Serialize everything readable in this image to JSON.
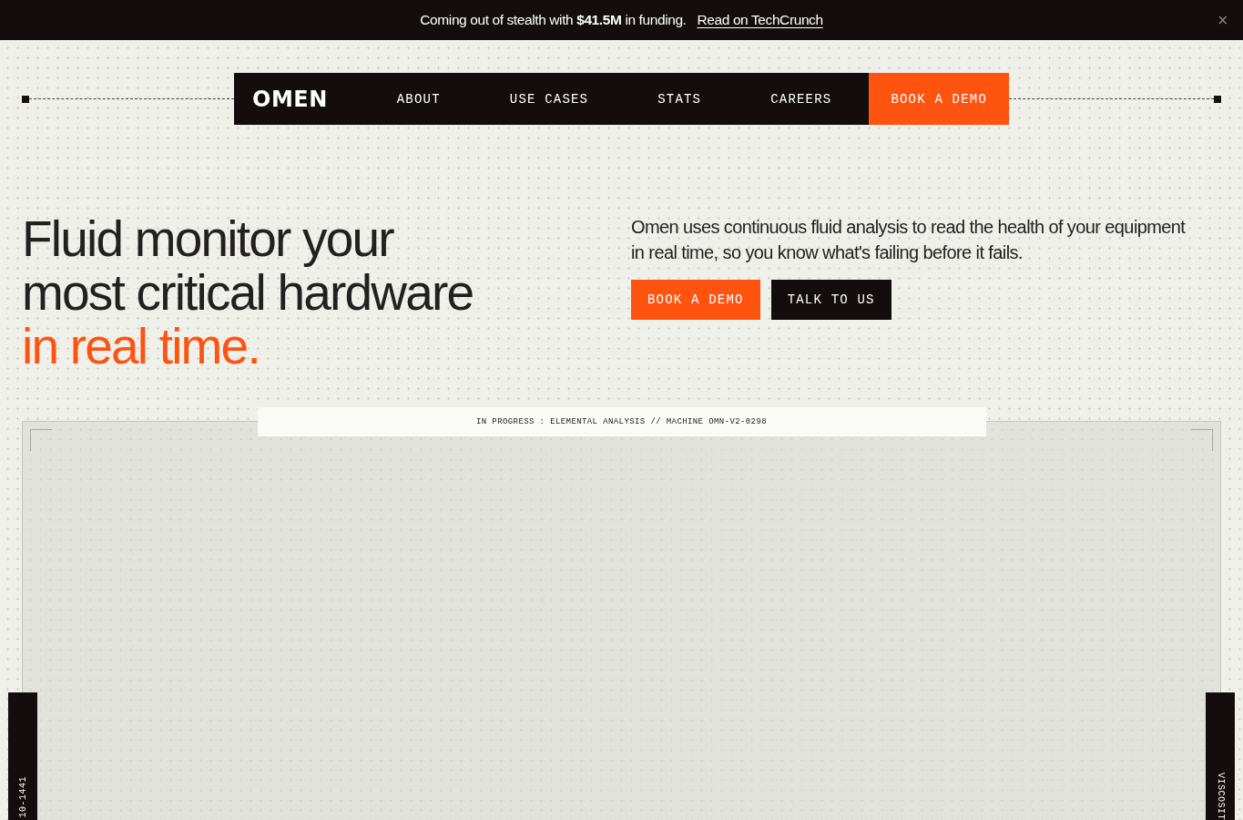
{
  "announcement": {
    "text": "Coming out of stealth with **$41.5M** in funding.",
    "link": "Read on TechCrunch",
    "close": "×"
  },
  "nav": {
    "logo": "OMEN",
    "items": [
      {
        "label": "ABOUT",
        "kind": "link"
      },
      {
        "label": "USE CASES",
        "kind": "link"
      },
      {
        "label": "STATS",
        "kind": "link"
      },
      {
        "label": "CAREERS",
        "kind": "link"
      },
      {
        "label": "BOOK A DEMO",
        "kind": "cta"
      }
    ]
  },
  "hero": {
    "headline_lines": [
      {
        "text": "Fluid monitor your",
        "accent": false
      },
      {
        "text": "most critical hardware",
        "accent": false
      },
      {
        "text": "in real time.",
        "accent": true
      }
    ],
    "description": "Omen uses continuous fluid analysis to read the health of your equipment in real time, so you know what's failing before it fails.",
    "buttons": [
      {
        "label": "BOOK A DEMO",
        "kind": "primary"
      },
      {
        "label": "TALK TO US",
        "kind": "secondary"
      }
    ]
  },
  "panel": {
    "status_label": "IN PROGRESS : ELEMENTAL ANALYSIS // MACHINE OMN-V2-0298",
    "side_tabs": [
      {
        "text": "10-1441",
        "kind": "left"
      },
      {
        "text": "VISCOSIT",
        "kind": "right"
      }
    ]
  }
}
